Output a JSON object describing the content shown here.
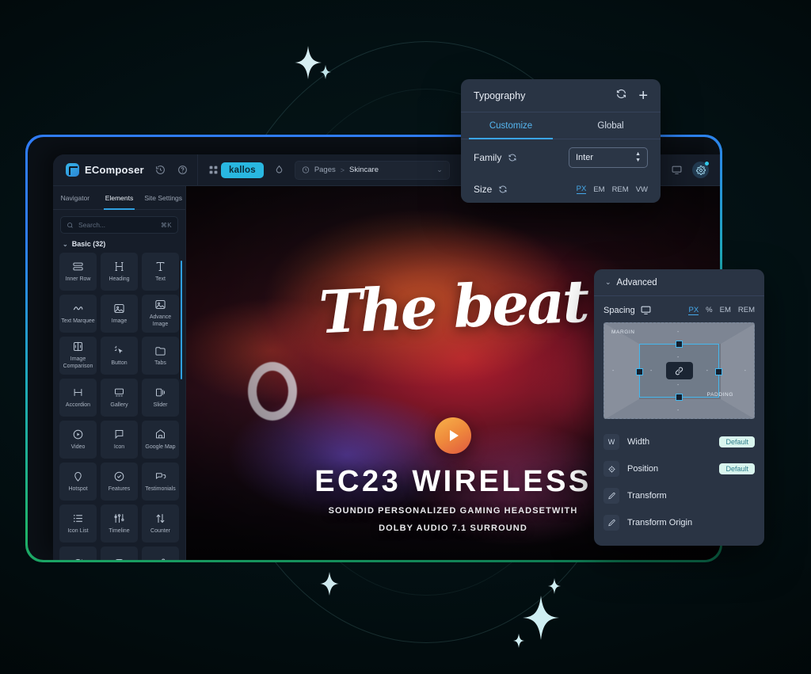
{
  "app": {
    "brand": "EComposer",
    "site_badge": "kallos",
    "topbar_icons": [
      "history-icon",
      "help-icon",
      "apps-grid-icon",
      "theme-icon",
      "monitor-icon",
      "settings-gear-icon"
    ],
    "breadcrumb": {
      "root": "Pages",
      "separator": ">",
      "current": "Skincare",
      "caret": "⌄"
    }
  },
  "sidebar": {
    "tabs": [
      {
        "label": "Navigator",
        "active": false
      },
      {
        "label": "Elements",
        "active": true
      },
      {
        "label": "Site Settings",
        "active": false
      }
    ],
    "search": {
      "placeholder": "Search...",
      "shortcut": "⌘K"
    },
    "section": {
      "chevron": "⌄",
      "label": "Basic (32)"
    },
    "elements": [
      {
        "label": "Inner Row",
        "icon": "inner-row-icon"
      },
      {
        "label": "Heading",
        "icon": "heading-icon"
      },
      {
        "label": "Text",
        "icon": "text-icon"
      },
      {
        "label": "Text Marquee",
        "icon": "marquee-icon"
      },
      {
        "label": "Image",
        "icon": "image-icon"
      },
      {
        "label": "Advance Image",
        "icon": "advance-image-icon"
      },
      {
        "label": "Image Comparison",
        "icon": "image-comparison-icon"
      },
      {
        "label": "Button",
        "icon": "button-cursor-icon"
      },
      {
        "label": "Tabs",
        "icon": "tabs-icon"
      },
      {
        "label": "Accordion",
        "icon": "accordion-icon"
      },
      {
        "label": "Gallery",
        "icon": "gallery-icon"
      },
      {
        "label": "Slider",
        "icon": "slider-icon"
      },
      {
        "label": "Video",
        "icon": "video-play-icon"
      },
      {
        "label": "Icon",
        "icon": "flag-icon"
      },
      {
        "label": "Google Map",
        "icon": "map-pin-icon"
      },
      {
        "label": "Hotspot",
        "icon": "hotspot-pin-icon"
      },
      {
        "label": "Features",
        "icon": "check-circle-icon"
      },
      {
        "label": "Testimonials",
        "icon": "testimonial-bubbles-icon"
      },
      {
        "label": "Icon List",
        "icon": "list-icon"
      },
      {
        "label": "Timeline",
        "icon": "timeline-icon"
      },
      {
        "label": "Counter",
        "icon": "counter-arrows-icon"
      },
      {
        "label": "",
        "icon": "countdown-icon"
      },
      {
        "label": "",
        "icon": "instagram-icon"
      },
      {
        "label": "",
        "icon": "share-icon"
      }
    ]
  },
  "canvas": {
    "script_text": "The beat",
    "play_button": "play-icon",
    "title": "EC23 WIRELESS",
    "subtitle_1": "SOUNDID PERSONALIZED GAMING HEADSETWITH",
    "subtitle_2": "DOLBY AUDIO 7.1 SURROUND"
  },
  "typography_panel": {
    "title": "Typography",
    "header_icons": [
      "reset-icon",
      "add-icon"
    ],
    "add_label": "+",
    "tabs": [
      {
        "label": "Customize",
        "active": true
      },
      {
        "label": "Global",
        "active": false
      }
    ],
    "family": {
      "label": "Family",
      "reset": "reset-icon",
      "value": "Inter"
    },
    "size": {
      "label": "Size",
      "reset": "reset-icon",
      "units": [
        {
          "label": "PX",
          "active": true
        },
        {
          "label": "EM",
          "active": false
        },
        {
          "label": "REM",
          "active": false
        },
        {
          "label": "VW",
          "active": false
        }
      ]
    }
  },
  "advanced_panel": {
    "chevron": "⌄",
    "title": "Advanced",
    "spacing": {
      "label": "Spacing",
      "device_icon": "monitor-icon",
      "units": [
        {
          "label": "PX",
          "active": true
        },
        {
          "label": "%",
          "active": false
        },
        {
          "label": "EM",
          "active": false
        },
        {
          "label": "REM",
          "active": false
        }
      ],
      "margin_label": "MARGIN",
      "padding_label": "PADDING",
      "dash": "-",
      "link_icon": "link-icon"
    },
    "rows": [
      {
        "icon": "w-icon",
        "icon_glyph": "W",
        "label": "Width",
        "badge": "Default"
      },
      {
        "icon": "position-icon",
        "icon_glyph": "",
        "label": "Position",
        "badge": "Default"
      },
      {
        "icon": "pencil-icon",
        "icon_glyph": "",
        "label": "Transform",
        "badge": ""
      },
      {
        "icon": "pencil-icon",
        "icon_glyph": "",
        "label": "Transform Origin",
        "badge": ""
      }
    ]
  },
  "colors": {
    "accent_blue": "#2f9fe0",
    "badge_cyan": "#29b7e0",
    "default_badge_bg": "#d9f5ee",
    "border_gradient_start": "#2f7cf6",
    "border_gradient_end": "#0c6f4e"
  }
}
